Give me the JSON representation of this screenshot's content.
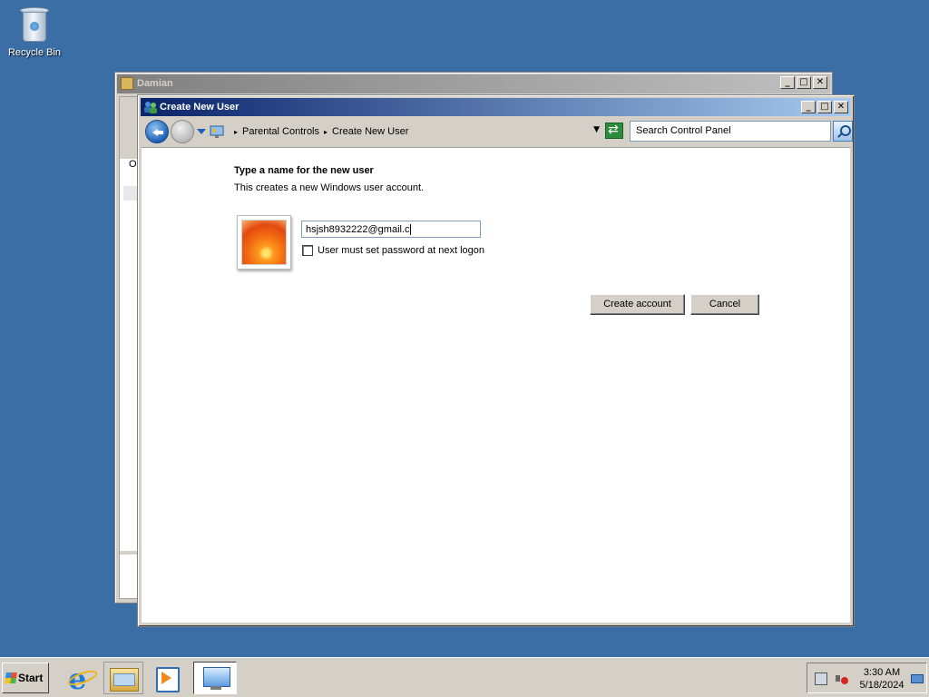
{
  "desktop": {
    "icons": [
      {
        "label": "Recycle Bin",
        "icon": "recycle-bin-icon"
      }
    ]
  },
  "background_window": {
    "title": "Damian",
    "partial_text": "O"
  },
  "window": {
    "title": "Create New User",
    "controls": {
      "minimize": "_",
      "maximize": "□",
      "close": "✕"
    }
  },
  "address_bar": {
    "breadcrumb": [
      "Parental Controls",
      "Create New User"
    ],
    "separator": "▸",
    "dropdown": "▼",
    "search_placeholder": "Search Control Panel"
  },
  "content": {
    "heading": "Type a name for the new user",
    "subtext": "This creates a new Windows user account.",
    "name_value": "hsjsh8932222@gmail.c",
    "checkbox_label": "User must set password at next logon",
    "checkbox_checked": false,
    "create_button": "Create account",
    "cancel_button": "Cancel"
  },
  "taskbar": {
    "start_label": "Start",
    "pinned": [
      "internet-explorer-icon",
      "windows-explorer-icon",
      "media-player-icon",
      "control-panel-icon"
    ],
    "clock_time": "3:30 AM",
    "clock_date": "5/18/2024"
  }
}
